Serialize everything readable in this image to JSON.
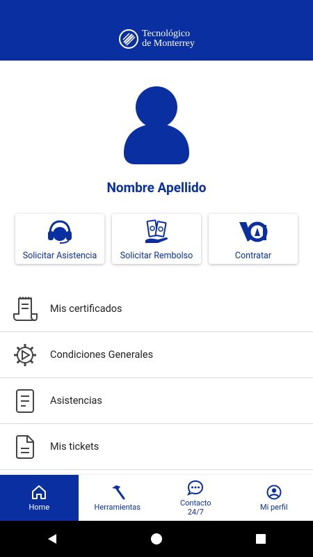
{
  "app": {
    "brand_line1": "Tecnológico",
    "brand_line2": "de Monterrey"
  },
  "profile": {
    "name": "Nombre Apellido"
  },
  "actions": [
    {
      "label": "Solicitar Asistencia",
      "icon": "headset-icon"
    },
    {
      "label": "Solicitar Rembolso",
      "icon": "money-hand-icon"
    },
    {
      "label": "Contratar",
      "icon": "contract-logo-icon"
    }
  ],
  "menu": [
    {
      "label": "Mis certificados",
      "icon": "receipt-icon"
    },
    {
      "label": "Condiciones Generales",
      "icon": "gear-icon"
    },
    {
      "label": "Asistencias",
      "icon": "document-icon"
    },
    {
      "label": "Mis tickets",
      "icon": "file-icon"
    }
  ],
  "bottom_nav": [
    {
      "label": "Home",
      "icon": "home-icon",
      "active": true
    },
    {
      "label": "Herramientas",
      "icon": "hammer-icon",
      "active": false
    },
    {
      "label": "Contacto\n24/7",
      "icon": "chat-icon",
      "active": false
    },
    {
      "label": "Mi perfil",
      "icon": "user-circle-icon",
      "active": false
    }
  ],
  "colors": {
    "primary": "#0a2fa0",
    "background": "#ffffff",
    "divider": "#d9d9d9"
  }
}
